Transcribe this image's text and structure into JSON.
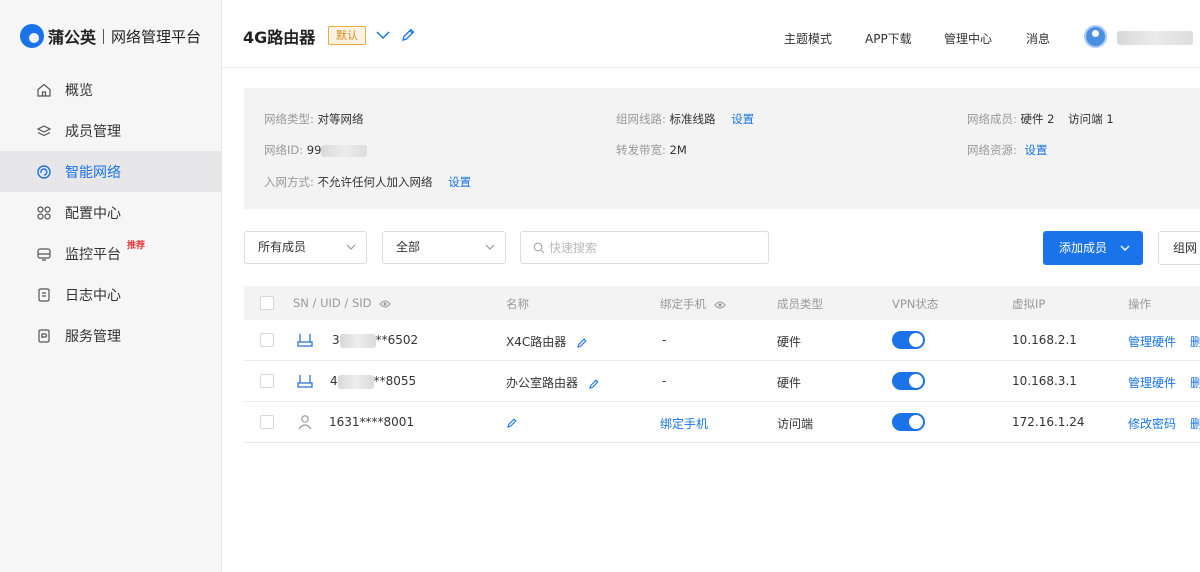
{
  "brand": {
    "name": "蒲公英",
    "subtitle": "网络管理平台"
  },
  "sidebar": {
    "items": [
      {
        "label": "概览"
      },
      {
        "label": "成员管理"
      },
      {
        "label": "智能网络"
      },
      {
        "label": "配置中心"
      },
      {
        "label": "监控平台",
        "badge": "推荐"
      },
      {
        "label": "日志中心"
      },
      {
        "label": "服务管理"
      }
    ],
    "active_index": 2
  },
  "header": {
    "title": "4G路由器",
    "tag": "默认",
    "links": [
      "主题模式",
      "APP下载",
      "管理中心",
      "消息"
    ]
  },
  "info": {
    "network_type_label": "网络类型:",
    "network_type_value": "对等网络",
    "network_id_label": "网络ID:",
    "network_id_value": "99",
    "join_label": "入网方式:",
    "join_value": "不允许任何人加入网络",
    "join_link": "设置",
    "routing_label": "组网线路:",
    "routing_value": "标准线路",
    "routing_link": "设置",
    "bandwidth_label": "转发带宽:",
    "bandwidth_value": "2M",
    "members_label": "网络成员:",
    "members_hw": "硬件 2",
    "members_visitor": "访问端 1",
    "resources_label": "网络资源:",
    "resources_link": "设置"
  },
  "filters": {
    "member_filter": "所有成员",
    "status_filter": "全部",
    "search_placeholder": "快速搜索",
    "add_button": "添加成员",
    "secondary_button": "组网"
  },
  "table": {
    "headers": [
      "SN / UID / SID",
      "名称",
      "绑定手机",
      "成员类型",
      "VPN状态",
      "虚拟IP",
      "操作"
    ],
    "rows": [
      {
        "icon": "router-icon",
        "id_prefix": "3",
        "id_suffix": "**6502",
        "name": "X4C路由器",
        "phone": "-",
        "type": "硬件",
        "vpn_on": true,
        "ip": "10.168.2.1",
        "action": "管理硬件",
        "more": "删"
      },
      {
        "icon": "router-icon",
        "id_prefix": "4",
        "id_suffix": "**8055",
        "name": "办公室路由器",
        "phone": "-",
        "type": "硬件",
        "vpn_on": true,
        "ip": "10.168.3.1",
        "action": "管理硬件",
        "more": "删"
      },
      {
        "icon": "user-icon",
        "id_prefix": "1631****8001",
        "id_suffix": "",
        "name": "",
        "phone": "绑定手机",
        "type": "访问端",
        "vpn_on": true,
        "ip": "172.16.1.24",
        "action": "修改密码",
        "more": "删"
      }
    ]
  },
  "colors": {
    "accent": "#1a73e8",
    "tag_border": "#f0a93b",
    "badge": "#e53935"
  }
}
